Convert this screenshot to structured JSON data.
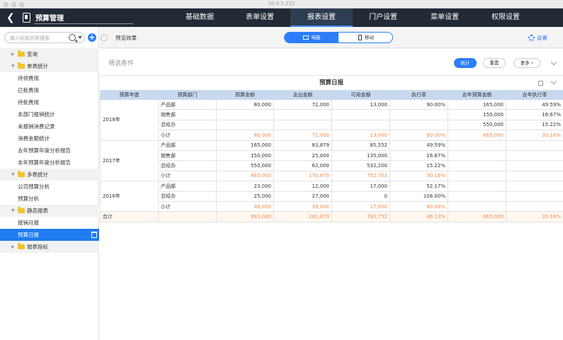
{
  "window": {
    "title": "10.0.1.222"
  },
  "app": {
    "title": "预算管理"
  },
  "nav": {
    "tabs": [
      "基础数据",
      "表单设置",
      "报表设置",
      "门户设置",
      "菜单设置",
      "权限设置"
    ],
    "active": "报表设置"
  },
  "sidebar": {
    "search_placeholder": "输入标题名称搜索",
    "items": [
      {
        "label": "查询",
        "type": "group",
        "expanded": false
      },
      {
        "label": "单表统计",
        "type": "group",
        "expanded": true
      },
      {
        "label": "待领费用",
        "type": "leaf"
      },
      {
        "label": "已批费用",
        "type": "leaf"
      },
      {
        "label": "待批费用",
        "type": "leaf"
      },
      {
        "label": "本部门报销统计",
        "type": "leaf"
      },
      {
        "label": "未报销消费记录",
        "type": "leaf"
      },
      {
        "label": "消费金额统计",
        "type": "leaf"
      },
      {
        "label": "去年预算年度分析报告",
        "type": "leaf"
      },
      {
        "label": "本年预算年度分析报告",
        "type": "leaf"
      },
      {
        "label": "多表统计",
        "type": "group",
        "expanded": true
      },
      {
        "label": "公司预算分析",
        "type": "leaf"
      },
      {
        "label": "预算分析",
        "type": "leaf"
      },
      {
        "label": "静态报表",
        "type": "group",
        "expanded": true
      },
      {
        "label": "报销月报",
        "type": "leaf"
      },
      {
        "label": "预算日报",
        "type": "leaf",
        "selected": true
      },
      {
        "label": "报表指标",
        "type": "group",
        "expanded": false
      }
    ]
  },
  "toolbar": {
    "preview_label": "预览效果",
    "seg_pc": "电脑",
    "seg_mobile": "移动",
    "settings_label": "设置"
  },
  "filter": {
    "label": "筛选条件",
    "btn_stat": "统计",
    "btn_reset": "重置",
    "btn_more": "更多"
  },
  "report": {
    "title": "预算日报",
    "headers": [
      "预算年度",
      "预算部门",
      "预算金额",
      "支出金额",
      "可用金额",
      "执行率",
      "去年预算金额",
      "去年执行率"
    ],
    "groups": [
      {
        "year": "2018年",
        "rows": [
          [
            "产品部",
            "80,000",
            "72,000",
            "13,000",
            "90.00%",
            "165,000",
            "49.59%"
          ],
          [
            "销售部",
            "",
            "",
            "",
            "",
            "150,000",
            "16.67%"
          ],
          [
            "总经办",
            "",
            "",
            "",
            "",
            "550,000",
            "15.22%"
          ],
          [
            "小计",
            "80,000",
            "72,000",
            "13,000",
            "90.00%",
            "865,000",
            "30.16%"
          ]
        ]
      },
      {
        "year": "2017年",
        "rows": [
          [
            "产品部",
            "165,000",
            "83,879",
            "85,552",
            "49.59%",
            "",
            ""
          ],
          [
            "销售部",
            "150,000",
            "25,000",
            "135,000",
            "16.67%",
            "",
            ""
          ],
          [
            "总经办",
            "550,000",
            "62,000",
            "532,200",
            "15.22%",
            "",
            ""
          ],
          [
            "小计",
            "865,000",
            "170,879",
            "752,752",
            "30.16%",
            "",
            ""
          ]
        ]
      },
      {
        "year": "2016年",
        "rows": [
          [
            "产品部",
            "23,000",
            "12,000",
            "17,000",
            "52.17%",
            "",
            ""
          ],
          [
            "总经办",
            "25,000",
            "27,000",
            "0",
            "108.00%",
            "",
            ""
          ],
          [
            "小计",
            "48,000",
            "39,000",
            "17,000",
            "80.08%",
            "",
            ""
          ]
        ]
      }
    ],
    "total": [
      "合计",
      "",
      "993,000",
      "281,879",
      "782,752",
      "46.13%",
      "865,000",
      "30.16%"
    ]
  },
  "colors": {
    "accent": "#2c7ef8",
    "nav_bg": "#222a35",
    "subtotal": "#f08c4a",
    "header_bg": "#c7d9f0"
  }
}
